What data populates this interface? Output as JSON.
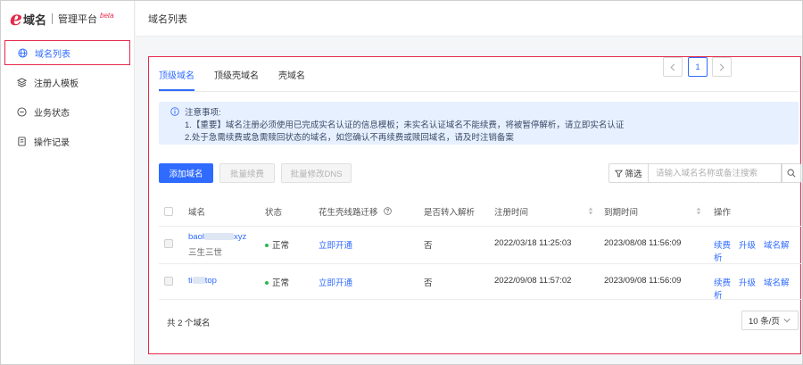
{
  "brand": {
    "domain": "域名",
    "platform": "管理平台",
    "beta": "beta"
  },
  "sidebar": {
    "items": [
      {
        "label": "域名列表",
        "icon": "globe-icon",
        "active": true
      },
      {
        "label": "注册人模板",
        "icon": "layers-icon"
      },
      {
        "label": "业务状态",
        "icon": "status-icon"
      },
      {
        "label": "操作记录",
        "icon": "document-icon"
      }
    ]
  },
  "header": {
    "title": "域名列表"
  },
  "tabs": [
    {
      "label": "顶级域名",
      "active": true
    },
    {
      "label": "顶级壳域名"
    },
    {
      "label": "壳域名"
    }
  ],
  "notice": {
    "title": "注意事项:",
    "line1": "1.【重要】域名注册必须使用已完成实名认证的信息模板；未实名认证域名不能续费，将被暂停解析，请立即实名认证",
    "line2": "2.处于急需续费或急需赎回状态的域名，如您确认不再续费或赎回域名，请及时注销备案"
  },
  "toolbar": {
    "add_label": "添加域名",
    "renew_label": "批量续费",
    "dns_label": "批量修改DNS",
    "filter_label": "筛选",
    "search_placeholder": "请输入域名名称或备注搜索"
  },
  "table": {
    "headers": {
      "name": "域名",
      "status": "状态",
      "migrate": "花生壳线路迁移",
      "resolve": "是否转入解析",
      "registered": "注册时间",
      "expires": "到期时间",
      "actions": "操作"
    },
    "rows": [
      {
        "name_prefix": "baol",
        "name_suffix": "xyz",
        "remark": "三生三世",
        "status": "正常",
        "migrate": "立即开通",
        "resolve": "否",
        "registered": "2022/03/18 11:25:03",
        "expires": "2023/08/08 11:56:09",
        "ops": [
          "续费",
          "升级",
          "域名解析"
        ]
      },
      {
        "name_prefix": "ti",
        "name_suffix": "top",
        "remark": "",
        "status": "正常",
        "migrate": "立即开通",
        "resolve": "否",
        "registered": "2022/09/08 11:57:02",
        "expires": "2023/09/08 11:56:09",
        "ops": [
          "续费",
          "升级",
          "域名解析"
        ]
      }
    ]
  },
  "footer": {
    "count": "共 2 个域名",
    "page": "1",
    "page_size": "10 条/页"
  },
  "colors": {
    "accent": "#2f6bff",
    "brand": "#e5294b",
    "status_ok": "#2db84d",
    "notice_bg": "#e7f0ff"
  }
}
